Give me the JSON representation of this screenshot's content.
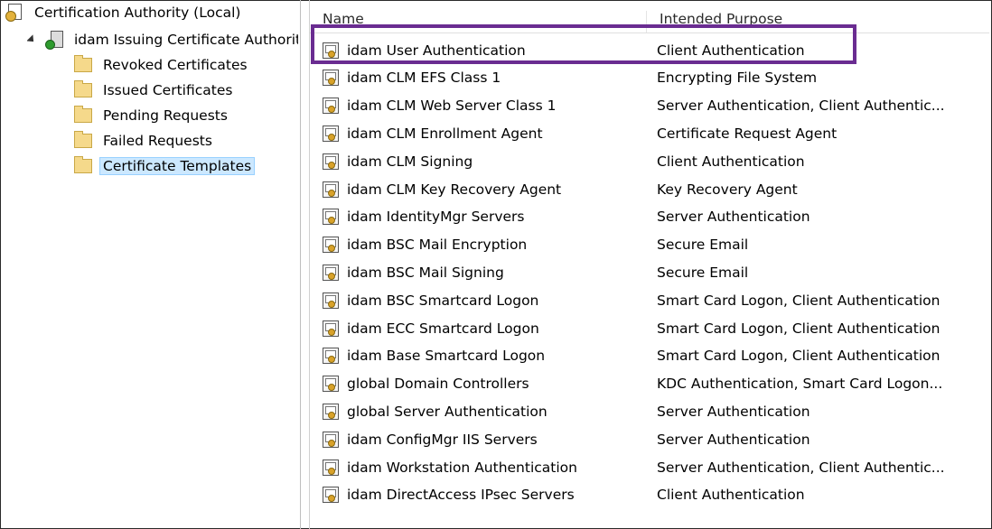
{
  "tree": {
    "root_label": "Certification Authority (Local)",
    "ca_label": "idam Issuing Certificate Authority",
    "folders": [
      {
        "label": "Revoked Certificates"
      },
      {
        "label": "Issued Certificates"
      },
      {
        "label": "Pending Requests"
      },
      {
        "label": "Failed Requests"
      },
      {
        "label": "Certificate Templates",
        "selected": true
      }
    ]
  },
  "columns": {
    "name": "Name",
    "purpose": "Intended Purpose"
  },
  "rows": [
    {
      "name": "idam User Authentication",
      "purpose": "Client Authentication"
    },
    {
      "name": "idam CLM EFS Class 1",
      "purpose": "Encrypting File System"
    },
    {
      "name": "idam CLM Web Server Class 1",
      "purpose": "Server Authentication, Client Authentic..."
    },
    {
      "name": "idam CLM Enrollment Agent",
      "purpose": "Certificate Request Agent"
    },
    {
      "name": "idam CLM Signing",
      "purpose": "Client Authentication"
    },
    {
      "name": "idam CLM Key Recovery Agent",
      "purpose": "Key Recovery Agent"
    },
    {
      "name": "idam IdentityMgr Servers",
      "purpose": "Server Authentication"
    },
    {
      "name": "idam BSC Mail Encryption",
      "purpose": "Secure Email"
    },
    {
      "name": "idam BSC Mail Signing",
      "purpose": "Secure Email"
    },
    {
      "name": "idam BSC Smartcard Logon",
      "purpose": "Smart Card Logon, Client Authentication"
    },
    {
      "name": "idam ECC Smartcard Logon",
      "purpose": "Smart Card Logon, Client Authentication"
    },
    {
      "name": "idam Base Smartcard Logon",
      "purpose": "Smart Card Logon, Client Authentication"
    },
    {
      "name": "global Domain Controllers",
      "purpose": "KDC Authentication, Smart Card Logon..."
    },
    {
      "name": "global Server Authentication",
      "purpose": "Server Authentication"
    },
    {
      "name": "idam ConfigMgr IIS Servers",
      "purpose": "Server Authentication"
    },
    {
      "name": "idam Workstation Authentication",
      "purpose": "Server Authentication, Client Authentic..."
    },
    {
      "name": "idam DirectAccess IPsec Servers",
      "purpose": "Client Authentication"
    }
  ],
  "highlight": {
    "color": "#6a2c91",
    "row_index": 0
  },
  "icons": {
    "root": "certificate-authority-icon",
    "ca": "ca-server-icon",
    "folder": "folder-icon",
    "template": "certificate-template-icon"
  }
}
